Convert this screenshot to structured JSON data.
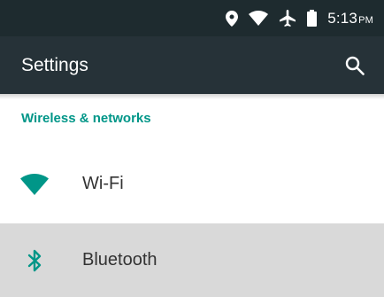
{
  "status_bar": {
    "time": "5:13",
    "ampm": "PM",
    "icons": [
      "location-icon",
      "wifi-signal-icon",
      "airplane-icon",
      "battery-icon"
    ]
  },
  "toolbar": {
    "title": "Settings",
    "search_icon": "search-icon"
  },
  "section": {
    "title": "Wireless & networks"
  },
  "items": [
    {
      "label": "Wi-Fi",
      "icon": "wifi-icon"
    },
    {
      "label": "Bluetooth",
      "icon": "bluetooth-icon",
      "highlighted": true
    }
  ],
  "colors": {
    "status_bar": "#1e2b2f",
    "toolbar": "#263238",
    "accent": "#009688",
    "highlight": "#d9d9d9"
  }
}
